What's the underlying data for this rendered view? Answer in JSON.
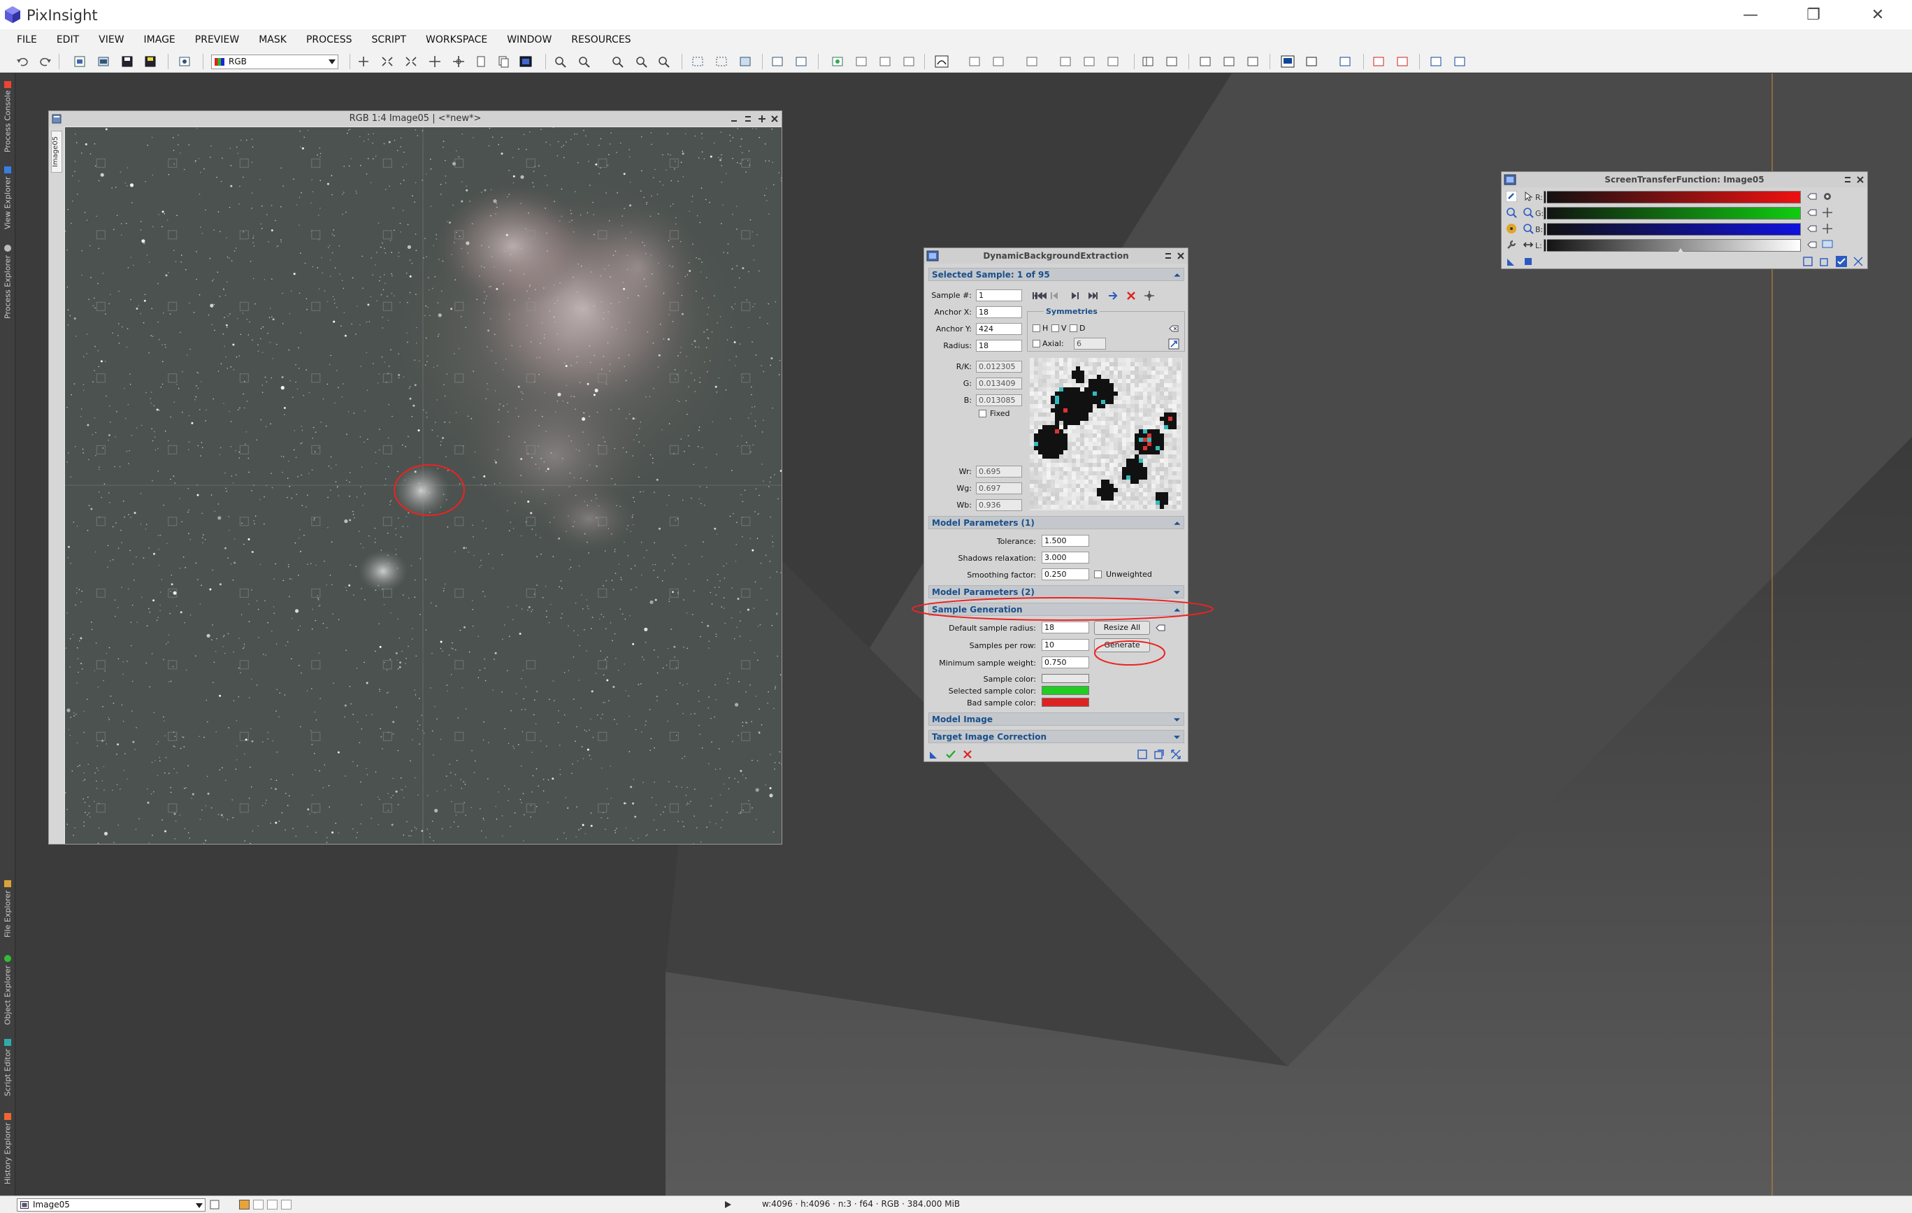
{
  "app": {
    "title": "PixInsight"
  },
  "window_controls": {
    "minimize": "—",
    "restore": "❐",
    "close": "✕"
  },
  "menu": [
    "FILE",
    "EDIT",
    "VIEW",
    "IMAGE",
    "PREVIEW",
    "MASK",
    "PROCESS",
    "SCRIPT",
    "WORKSPACE",
    "WINDOW",
    "RESOURCES"
  ],
  "toolbar": {
    "color_space": "RGB"
  },
  "left_tabs": [
    "Process Console",
    "View Explorer",
    "Process Explorer",
    "File Explorer",
    "Object Explorer",
    "Script Editor",
    "History Explorer"
  ],
  "image_window": {
    "title": "RGB 1:4 Image05 | <*new*>",
    "side_label": "Image05"
  },
  "dbe": {
    "title": "DynamicBackgroundExtraction",
    "selected_sample": "Selected Sample: 1 of 95",
    "sample_label": "Sample #:",
    "sample_value": "1",
    "anchor_x_label": "Anchor X:",
    "anchor_x": "18",
    "anchor_y_label": "Anchor Y:",
    "anchor_y": "424",
    "radius_label": "Radius:",
    "radius": "18",
    "symmetries_label": "Symmetries",
    "sym_h": "H",
    "sym_v": "V",
    "sym_d": "D",
    "axial_label": "Axial:",
    "axial_value": "6",
    "rk_label": "R/K:",
    "rk": "0.012305",
    "g_label": "G:",
    "g": "0.013409",
    "b_label": "B:",
    "b": "0.013085",
    "fixed_label": "Fixed",
    "wr_label": "Wr:",
    "wr": "0.695",
    "wg_label": "Wg:",
    "wg": "0.697",
    "wb_label": "Wb:",
    "wb": "0.936",
    "model_params_1": "Model Parameters (1)",
    "tolerance_label": "Tolerance:",
    "tolerance": "1.500",
    "shadows_label": "Shadows relaxation:",
    "shadows": "3.000",
    "smoothing_label": "Smoothing factor:",
    "smoothing": "0.250",
    "unweighted_label": "Unweighted",
    "model_params_2": "Model Parameters (2)",
    "sample_generation": "Sample Generation",
    "default_radius_label": "Default sample radius:",
    "default_radius": "18",
    "resize_all": "Resize All",
    "per_row_label": "Samples per row:",
    "per_row": "10",
    "generate": "Generate",
    "min_weight_label": "Minimum sample weight:",
    "min_weight": "0.750",
    "sample_color_label": "Sample color:",
    "selected_color_label": "Selected sample color:",
    "bad_color_label": "Bad sample color:",
    "model_image": "Model Image",
    "target_correction": "Target Image Correction",
    "colors": {
      "sample": "#e8e8e8",
      "selected": "#22cc22",
      "bad": "#dd2222"
    }
  },
  "stf": {
    "title": "ScreenTransferFunction: Image05",
    "r": "R:",
    "g": "G:",
    "b": "B:",
    "l": "L:"
  },
  "status": {
    "view": "Image05",
    "info": "w:4096 · h:4096 · n:3 · f64 · RGB · 384.000 MiB"
  }
}
